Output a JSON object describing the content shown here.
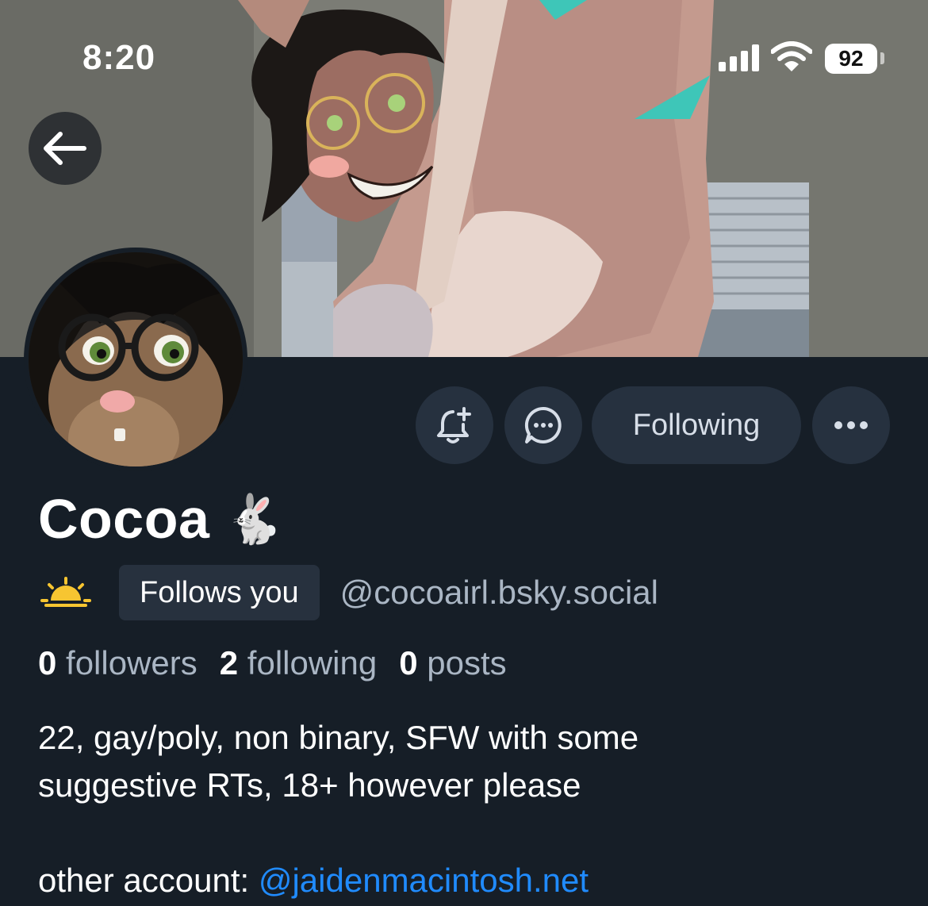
{
  "status_bar": {
    "time": "8:20",
    "battery": "92",
    "icons": [
      "signal-icon",
      "wifi-icon",
      "battery-icon"
    ]
  },
  "navigation": {
    "back_icon": "arrow-left-icon"
  },
  "profile": {
    "display_name": "Cocoa",
    "name_emoji": "🐇",
    "status_emoji": "sunrise-icon",
    "follows_badge": "Follows you",
    "handle": "@cocoairl.bsky.social"
  },
  "actions": {
    "notify_icon": "bell-plus-icon",
    "message_icon": "chat-bubble-icon",
    "following_label": "Following",
    "more_icon": "ellipsis-icon"
  },
  "stats": {
    "followers_count": "0",
    "followers_label": "followers",
    "following_count": "2",
    "following_label": "following",
    "posts_count": "0",
    "posts_label": "posts"
  },
  "bio": {
    "line1": "22, gay/poly, non binary, SFW with some",
    "line2": "suggestive RTs, 18+ however please",
    "line3_prefix": "other account: ",
    "line3_link": "@jaidenmacintosh.net"
  },
  "colors": {
    "background": "#161e27",
    "button_bg": "#26313f",
    "muted_text": "#aab6c4",
    "link": "#208bfe"
  }
}
